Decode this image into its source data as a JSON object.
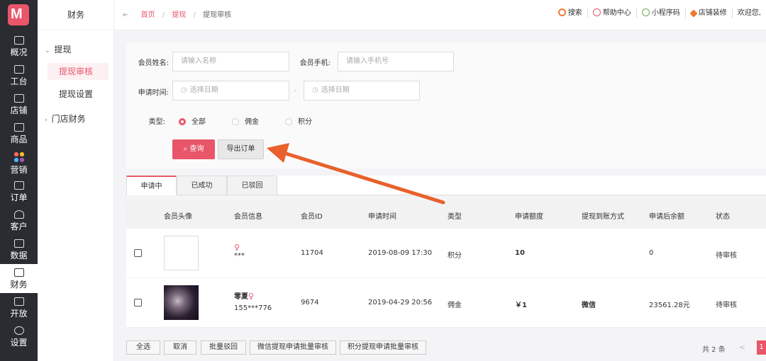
{
  "brand": {
    "logo_letter": "M",
    "accent": "#e9566a"
  },
  "rail": [
    {
      "label": "概况",
      "icon": "monitor-icon"
    },
    {
      "label": "工台",
      "icon": "desktop-icon"
    },
    {
      "label": "店铺",
      "icon": "store-icon"
    },
    {
      "label": "商品",
      "icon": "bag-icon"
    },
    {
      "label": "营销",
      "icon": "apps-icon"
    },
    {
      "label": "订单",
      "icon": "order-icon"
    },
    {
      "label": "客户",
      "icon": "user-icon"
    },
    {
      "label": "数据",
      "icon": "chart-icon"
    },
    {
      "label": "财务",
      "icon": "finance-icon",
      "active": true
    },
    {
      "label": "开放",
      "icon": "code-icon"
    },
    {
      "label": "设置",
      "icon": "gear-icon"
    }
  ],
  "subside": {
    "title": "财务",
    "group1": "提现",
    "leaf_active": "提现审核",
    "leaf2": "提现设置",
    "group2": "门店财务"
  },
  "topbar": {
    "crumb_home": "首页",
    "crumb_mid": "提现",
    "crumb_current": "提现审核",
    "search": "搜索",
    "help": "帮助中心",
    "miniapp": "小程序码",
    "decorate": "店铺装修",
    "welcome": "欢迎您,"
  },
  "filter": {
    "name_label": "会员姓名:",
    "name_placeholder": "请输入名称",
    "phone_label": "会员手机:",
    "phone_placeholder": "请输入手机号",
    "date_label": "申请时间:",
    "date_start": "选择日期",
    "date_end": "选择日期",
    "date_sep": "-",
    "type_label": "类型:",
    "type_all": "全部",
    "type_commission": "佣金",
    "type_points": "积分",
    "query_btn": "查询",
    "export_btn": "导出订单"
  },
  "tabs": [
    "申请中",
    "已成功",
    "已驳回"
  ],
  "table": {
    "headers": [
      "会员头像",
      "会员信息",
      "会员ID",
      "申请时间",
      "类型",
      "申请额度",
      "提现到账方式",
      "申请后余额",
      "状态"
    ],
    "rows": [
      {
        "name": "",
        "sub": "***",
        "id": "11704",
        "time": "2019-08-09 17:30",
        "type": "积分",
        "amount": "10",
        "method": "",
        "balance": "0",
        "status": "待审核"
      },
      {
        "name": "零夏",
        "sub": "155***776",
        "id": "9674",
        "time": "2019-04-29 20:56",
        "type": "佣金",
        "amount": "￥1",
        "method": "微信",
        "balance": "23561.28元",
        "status": "待审核"
      }
    ]
  },
  "bottom": {
    "select_all": "全选",
    "cancel": "取消",
    "batch_reject": "批量驳回",
    "wechat_batch": "微信提现申请批量审核",
    "points_batch": "积分提现申请批量审核",
    "total": "共 2 条",
    "prev": "<",
    "page": "1"
  }
}
